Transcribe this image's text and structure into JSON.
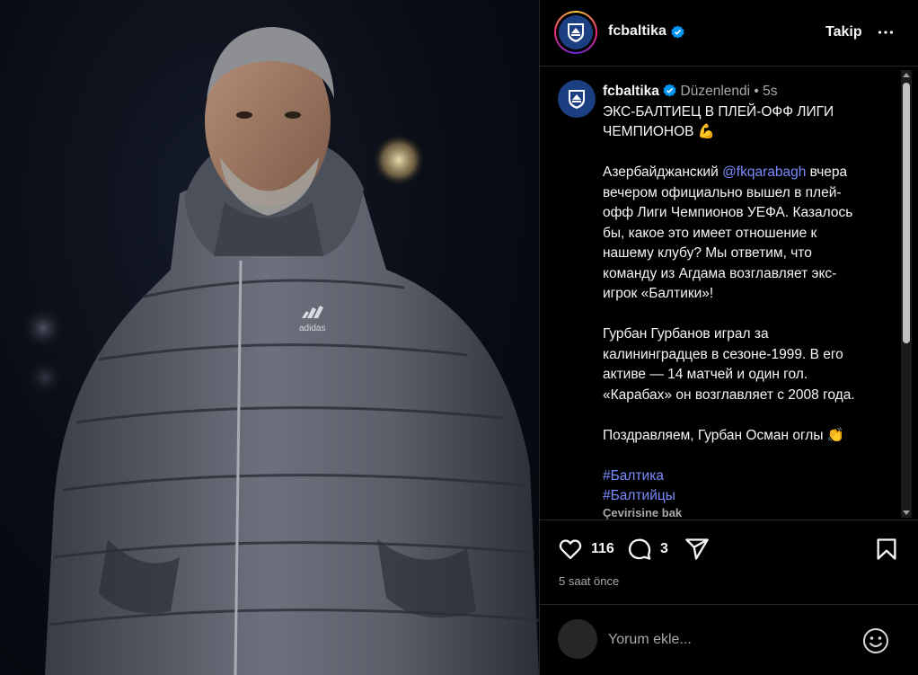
{
  "post": {
    "image_logo_text": "adidas",
    "header": {
      "username": "fcbaltika",
      "follow_label": "Takip"
    },
    "caption": {
      "username": "fcbaltika",
      "edited": "Düzenlendi",
      "time_ago": "5s",
      "line1": "ЭКС-БАЛТИЕЦ В ПЛЕЙ-ОФФ ЛИГИ",
      "line2": "ЧЕМПИОНОВ 💪",
      "para2_line1_a": "Азербайджанский ",
      "para2_mention": "@fkqarabagh",
      "para2_line1_b": " вчера",
      "para2_line2": "вечером официально вышел в плей-",
      "para2_line3": "офф Лиги Чемпионов УЕФА. Казалось",
      "para2_line4": "бы, какое это имеет отношение к",
      "para2_line5": "нашему клубу? Мы ответим, что",
      "para2_line6": "команду из Агдама возглавляет экс-",
      "para2_line7": "игрок «Балтики»!",
      "para3_line1": "Гурбан Гурбанов играл за",
      "para3_line2": "калининградцев в сезоне-1999. В его",
      "para3_line3": "активе — 14 матчей и один гол.",
      "para3_line4": "«Карабах» он возглавляет с 2008 года.",
      "para4_line1": "Поздравляем, Гурбан Осман оглы 👏",
      "hashtag1": "#Балтика",
      "hashtag2": "#Балтийцы",
      "translate_label": "Çevirisine bak"
    },
    "actions": {
      "likes": "116",
      "comments": "3",
      "posted_time": "5 saat önce"
    },
    "comment_box": {
      "placeholder": "Yorum ekle..."
    }
  },
  "icons": [
    "verified-icon",
    "more-icon",
    "heart-icon",
    "comment-icon",
    "share-icon",
    "bookmark-icon",
    "emoji-icon",
    "club-logo-icon"
  ],
  "colors": {
    "link": "#7a8cff",
    "verified": "#0095f6",
    "club": "#1c3f82"
  }
}
